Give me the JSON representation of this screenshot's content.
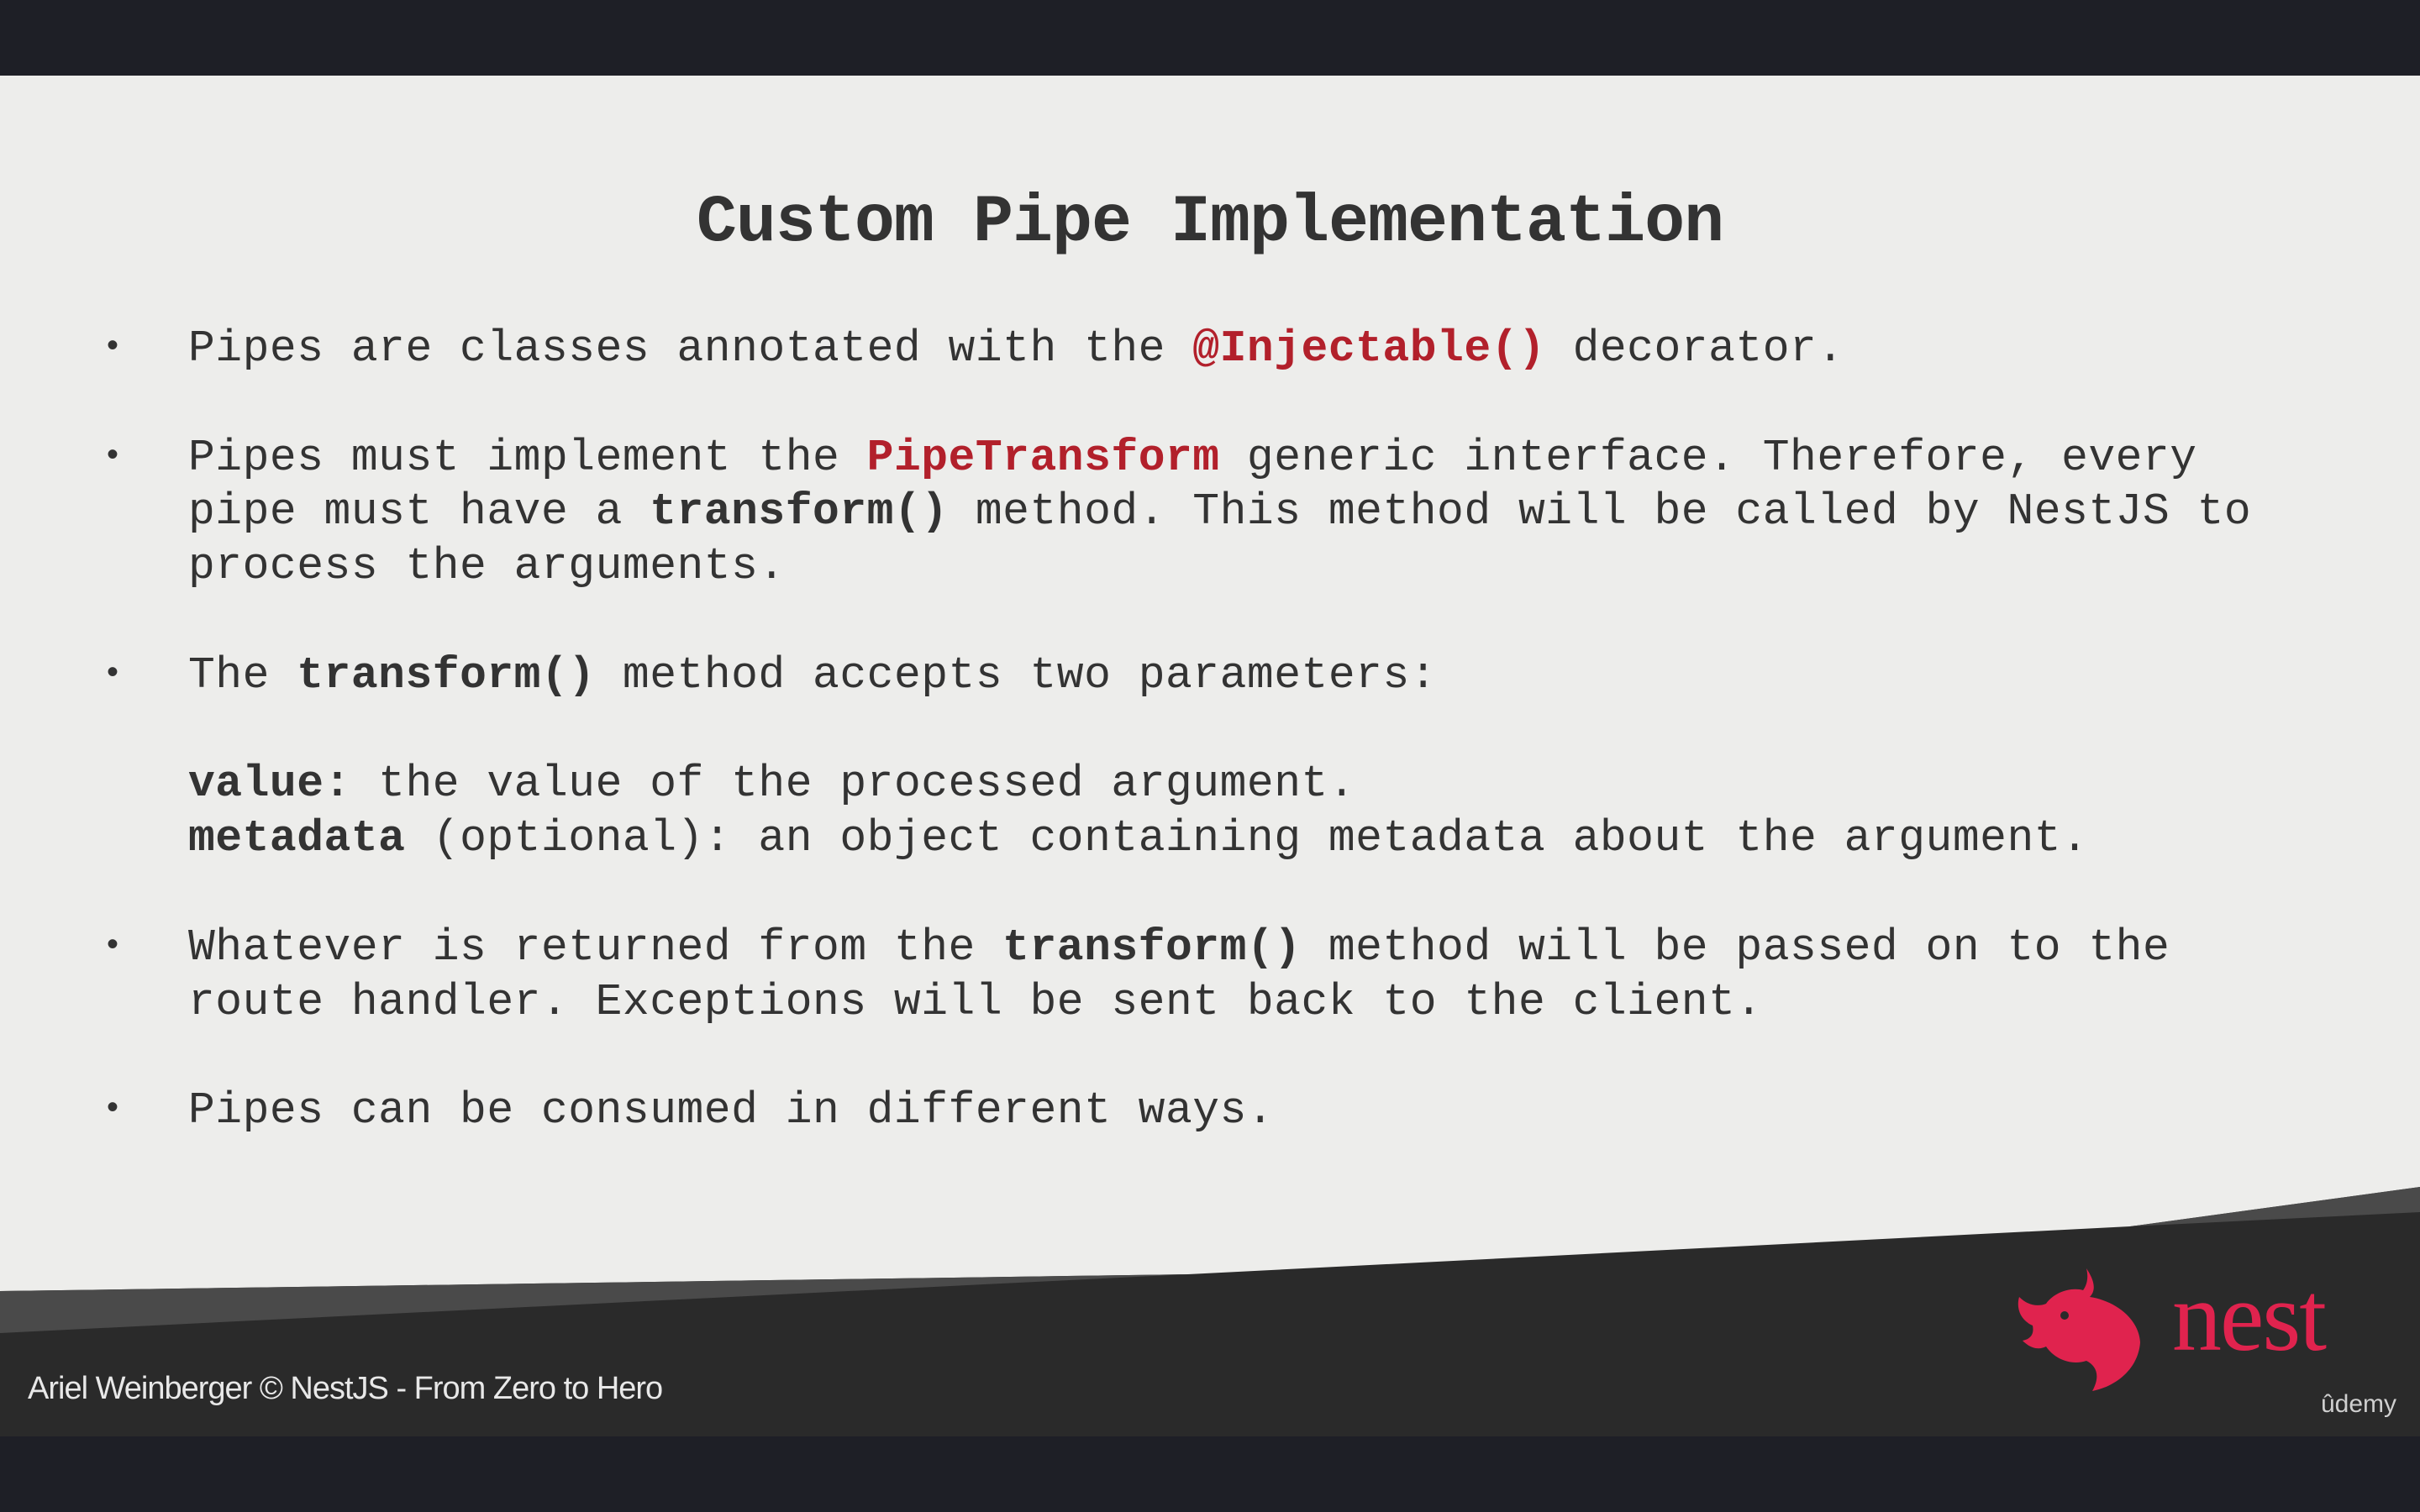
{
  "slide": {
    "title": "Custom Pipe Implementation",
    "bullet_symbol": "•",
    "lines": [
      {
        "row": 0,
        "bullet": true,
        "segments": [
          {
            "t": "Pipes are classes annotated with the ",
            "s": "n"
          },
          {
            "t": "@Injectable()",
            "s": "r"
          },
          {
            "t": " decorator.",
            "s": "n"
          }
        ]
      },
      {
        "row": 2,
        "bullet": true,
        "segments": [
          {
            "t": "Pipes must implement the ",
            "s": "n"
          },
          {
            "t": "PipeTransform",
            "s": "r"
          },
          {
            "t": " generic interface. Therefore, every",
            "s": "n"
          }
        ]
      },
      {
        "row": 3,
        "bullet": false,
        "segments": [
          {
            "t": "pipe must have a ",
            "s": "n"
          },
          {
            "t": "transform()",
            "s": "b"
          },
          {
            "t": " method. This method will be called by NestJS to",
            "s": "n"
          }
        ]
      },
      {
        "row": 4,
        "bullet": false,
        "segments": [
          {
            "t": "process the arguments.",
            "s": "n"
          }
        ]
      },
      {
        "row": 6,
        "bullet": true,
        "segments": [
          {
            "t": "The ",
            "s": "n"
          },
          {
            "t": "transform()",
            "s": "b"
          },
          {
            "t": " method accepts two parameters:",
            "s": "n"
          }
        ]
      },
      {
        "row": 8,
        "bullet": false,
        "segments": [
          {
            "t": "value:",
            "s": "b"
          },
          {
            "t": " the value of the processed argument.",
            "s": "n"
          }
        ]
      },
      {
        "row": 9,
        "bullet": false,
        "segments": [
          {
            "t": "metadata",
            "s": "b"
          },
          {
            "t": " (optional): an object containing metadata about the argument.",
            "s": "n"
          }
        ]
      },
      {
        "row": 11,
        "bullet": true,
        "segments": [
          {
            "t": "Whatever is returned from the ",
            "s": "n"
          },
          {
            "t": "transform()",
            "s": "b"
          },
          {
            "t": " method will be passed on to the",
            "s": "n"
          }
        ]
      },
      {
        "row": 12,
        "bullet": false,
        "segments": [
          {
            "t": "route handler. Exceptions will be sent back to the client.",
            "s": "n"
          }
        ]
      },
      {
        "row": 14,
        "bullet": true,
        "segments": [
          {
            "t": "Pipes can be consumed in different ways.",
            "s": "n"
          }
        ]
      }
    ]
  },
  "footer": {
    "credit": "Ariel Weinberger © NestJS - From Zero to Hero",
    "logo_text": "nest",
    "watermark": "ûdemy"
  },
  "colors": {
    "accent": "#b2202b",
    "logo": "#e0234e",
    "footer_dark": "#2a2a2a",
    "footer_band": "#4a4a4a"
  }
}
